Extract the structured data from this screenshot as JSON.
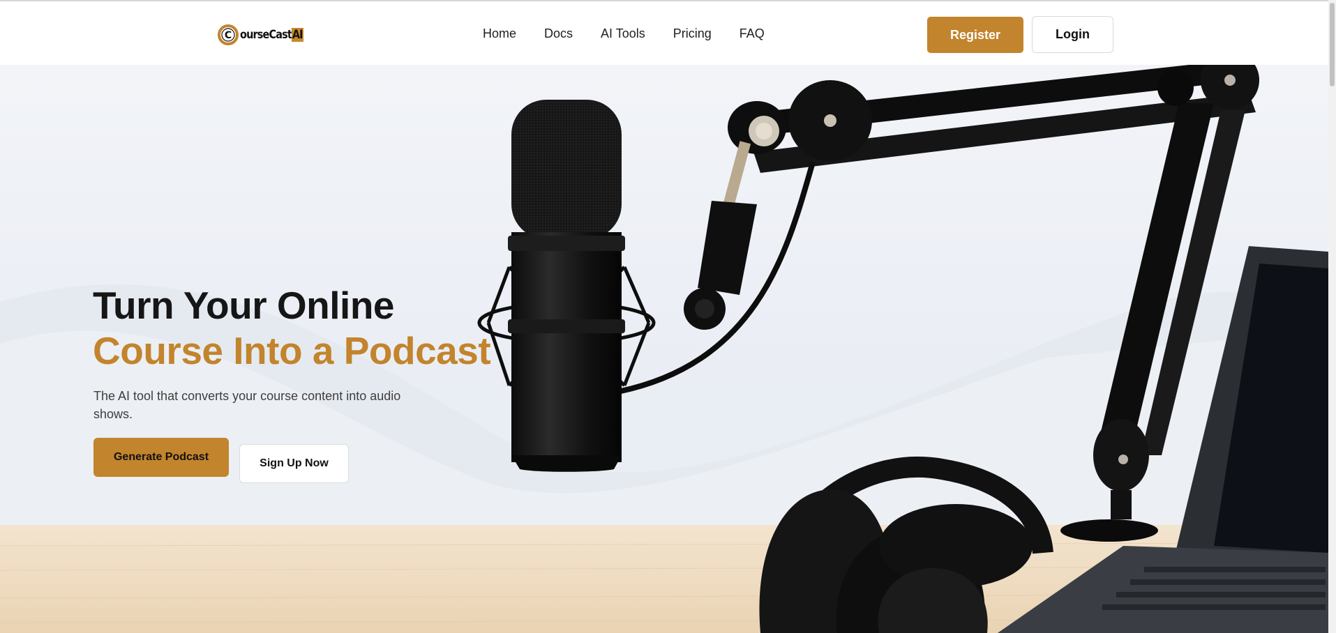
{
  "header": {
    "logo": {
      "letter": "C",
      "word": "ourseCast",
      "ai": "AI"
    },
    "nav": [
      {
        "label": "Home"
      },
      {
        "label": "Docs"
      },
      {
        "label": "AI Tools"
      },
      {
        "label": "Pricing"
      },
      {
        "label": "FAQ"
      }
    ],
    "register_label": "Register",
    "login_label": "Login"
  },
  "hero": {
    "title_line1": "Turn Your Online",
    "title_line2": "Course Into a Podcast",
    "subtitle": "The AI tool that converts your course content into audio shows.",
    "primary_cta": "Generate Podcast",
    "secondary_cta": "Sign Up Now",
    "image_subject": "studio microphone on boom arm with headphones and laptop on a wooden desk"
  },
  "icons": {
    "logo": "coursecast-logo-icon"
  },
  "colors": {
    "accent": "#c2842c",
    "heading": "#161616",
    "body_text": "#3e3e3e",
    "hero_bg": "#eef1f6",
    "desk": "#f1dfc6"
  }
}
